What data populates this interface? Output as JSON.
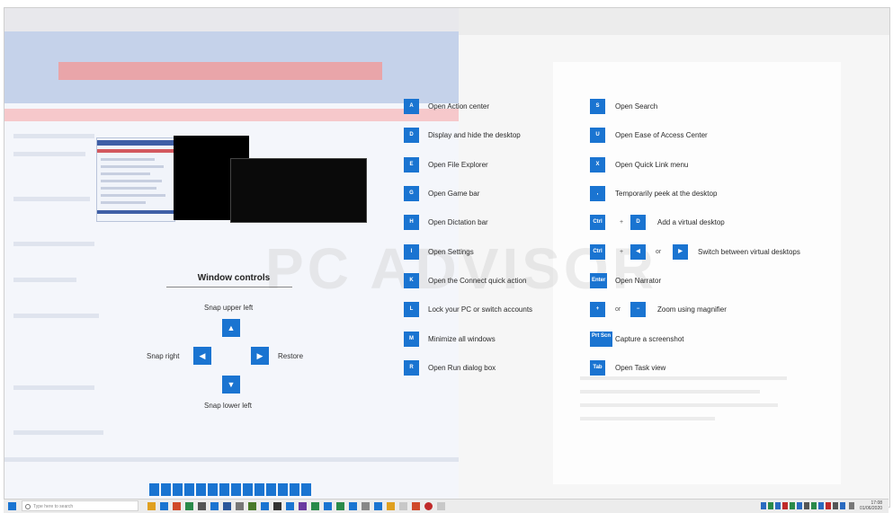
{
  "watermark": "PC ADVISOR",
  "window_controls": {
    "title": "Window controls",
    "snap_upper_left": "Snap upper left",
    "snap_right": "Snap right",
    "restore": "Restore",
    "snap_lower_left": "Snap lower left",
    "arrow_up": "▲",
    "arrow_left": "◀",
    "arrow_right": "▶",
    "arrow_down": "▼"
  },
  "shortcuts_left": [
    {
      "key": "A",
      "label": "Open Action center"
    },
    {
      "key": "D",
      "label": "Display and hide the desktop"
    },
    {
      "key": "E",
      "label": "Open File Explorer"
    },
    {
      "key": "G",
      "label": "Open Game bar"
    },
    {
      "key": "H",
      "label": "Open Dictation bar"
    },
    {
      "key": "I",
      "label": "Open Settings"
    },
    {
      "key": "K",
      "label": "Open the Connect quick action"
    },
    {
      "key": "L",
      "label": "Lock your PC or switch accounts"
    },
    {
      "key": "M",
      "label": "Minimize all windows"
    },
    {
      "key": "R",
      "label": "Open Run dialog box"
    }
  ],
  "shortcuts_right": {
    "search": {
      "key": "S",
      "label": "Open Search"
    },
    "ease": {
      "key": "U",
      "label": "Open Ease of Access Center"
    },
    "quicklink": {
      "key": "X",
      "label": "Open Quick Link menu"
    },
    "peek": {
      "key": ",",
      "label": "Temporarily peek at the desktop"
    },
    "add_desktop": {
      "key1": "Ctrl",
      "plus": "+",
      "key2": "D",
      "label": "Add a virtual desktop"
    },
    "switch_desktop": {
      "key1": "Ctrl",
      "plus": "+",
      "key2": "◀",
      "or": "or",
      "key3": "▶",
      "label": "Switch between virtual desktops"
    },
    "narrator": {
      "key": "Enter",
      "label": "Open Narrator"
    },
    "zoom": {
      "key1": "+",
      "or": "or",
      "key2": "−",
      "label": "Zoom using magnifier"
    },
    "screenshot": {
      "key": "Prt Scn",
      "label": "Capture a screenshot"
    },
    "taskview": {
      "key": "Tab",
      "label": "Open Task view"
    }
  },
  "taskbar": {
    "search_placeholder": "Type here to search",
    "time": "17:08",
    "date": "01/06/2020"
  },
  "colors": {
    "accent": "#1a74d1"
  }
}
